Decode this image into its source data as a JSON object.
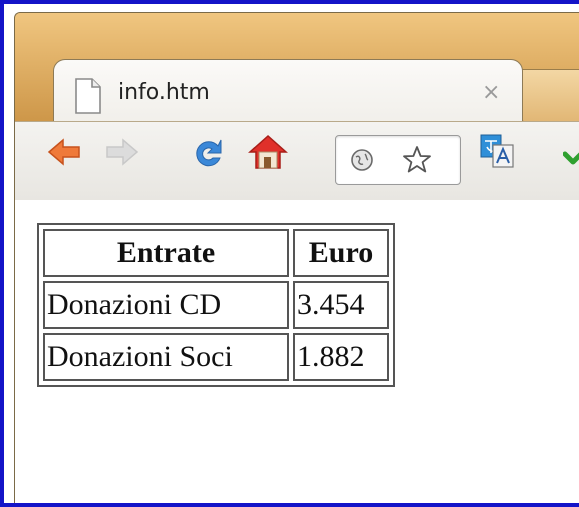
{
  "browser": {
    "tab": {
      "title": "info.htm",
      "close_glyph": "×",
      "icon": "page-icon"
    },
    "toolbar": {
      "back_icon": "back-arrow-icon",
      "forward_icon": "forward-arrow-icon",
      "reload_icon": "reload-icon",
      "home_icon": "home-icon",
      "page_info_icon": "globe-icon",
      "bookmark_icon": "star-icon",
      "translate_icon": "translate-icon",
      "extension_icon": "checkmark-icon"
    },
    "colors": {
      "frame_border": "#1414c8",
      "title_bar": "#d9a75e",
      "back_arrow": "#e8632a",
      "reload": "#3b88d8",
      "home_roof": "#e0302a",
      "checkmark": "#2fa02f"
    }
  },
  "table": {
    "headers": [
      "Entrate",
      "Euro"
    ],
    "rows": [
      [
        "Donazioni CD",
        "3.454"
      ],
      [
        "Donazioni Soci",
        "1.882"
      ]
    ]
  }
}
